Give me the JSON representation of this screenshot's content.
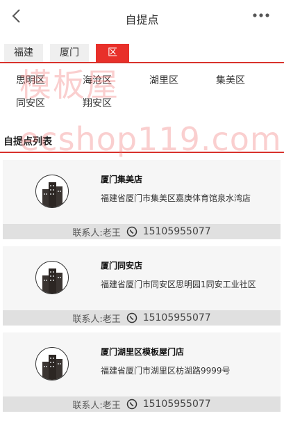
{
  "header": {
    "title": "自提点"
  },
  "tabs": [
    {
      "label": "福建"
    },
    {
      "label": "厦门"
    },
    {
      "label": "区"
    }
  ],
  "districts": [
    "思明区",
    "海沧区",
    "湖里区",
    "集美区",
    "同安区",
    "翔安区"
  ],
  "list_title": "自提点列表",
  "watermark": {
    "cn": "模板屋",
    "en": "ecshop119.com"
  },
  "stores": [
    {
      "name": "厦门集美店",
      "address": "福建省厦门市集美区嘉庚体育馆泉水湾店",
      "contact": "联系人:老王",
      "phone": "15105955077"
    },
    {
      "name": "厦门同安店",
      "address": "福建省厦门市同安区思明园1同安工业社区",
      "contact": "联系人:老王",
      "phone": "15105955077"
    },
    {
      "name": "厦门湖里区模板屋门店",
      "address": "福建省厦门市湖里区枋湖路9999号",
      "contact": "联系人:老王",
      "phone": "15105955077"
    }
  ],
  "colors": {
    "accent": "#e8302a",
    "tab_bg": "#efefef",
    "card_bg": "#f6f6f6",
    "contact_bg": "#e0e0e0"
  },
  "icons": {
    "back": "chevron-left-icon",
    "more": "more-dots-icon",
    "store": "building-icon",
    "phone": "wechat-icon"
  }
}
